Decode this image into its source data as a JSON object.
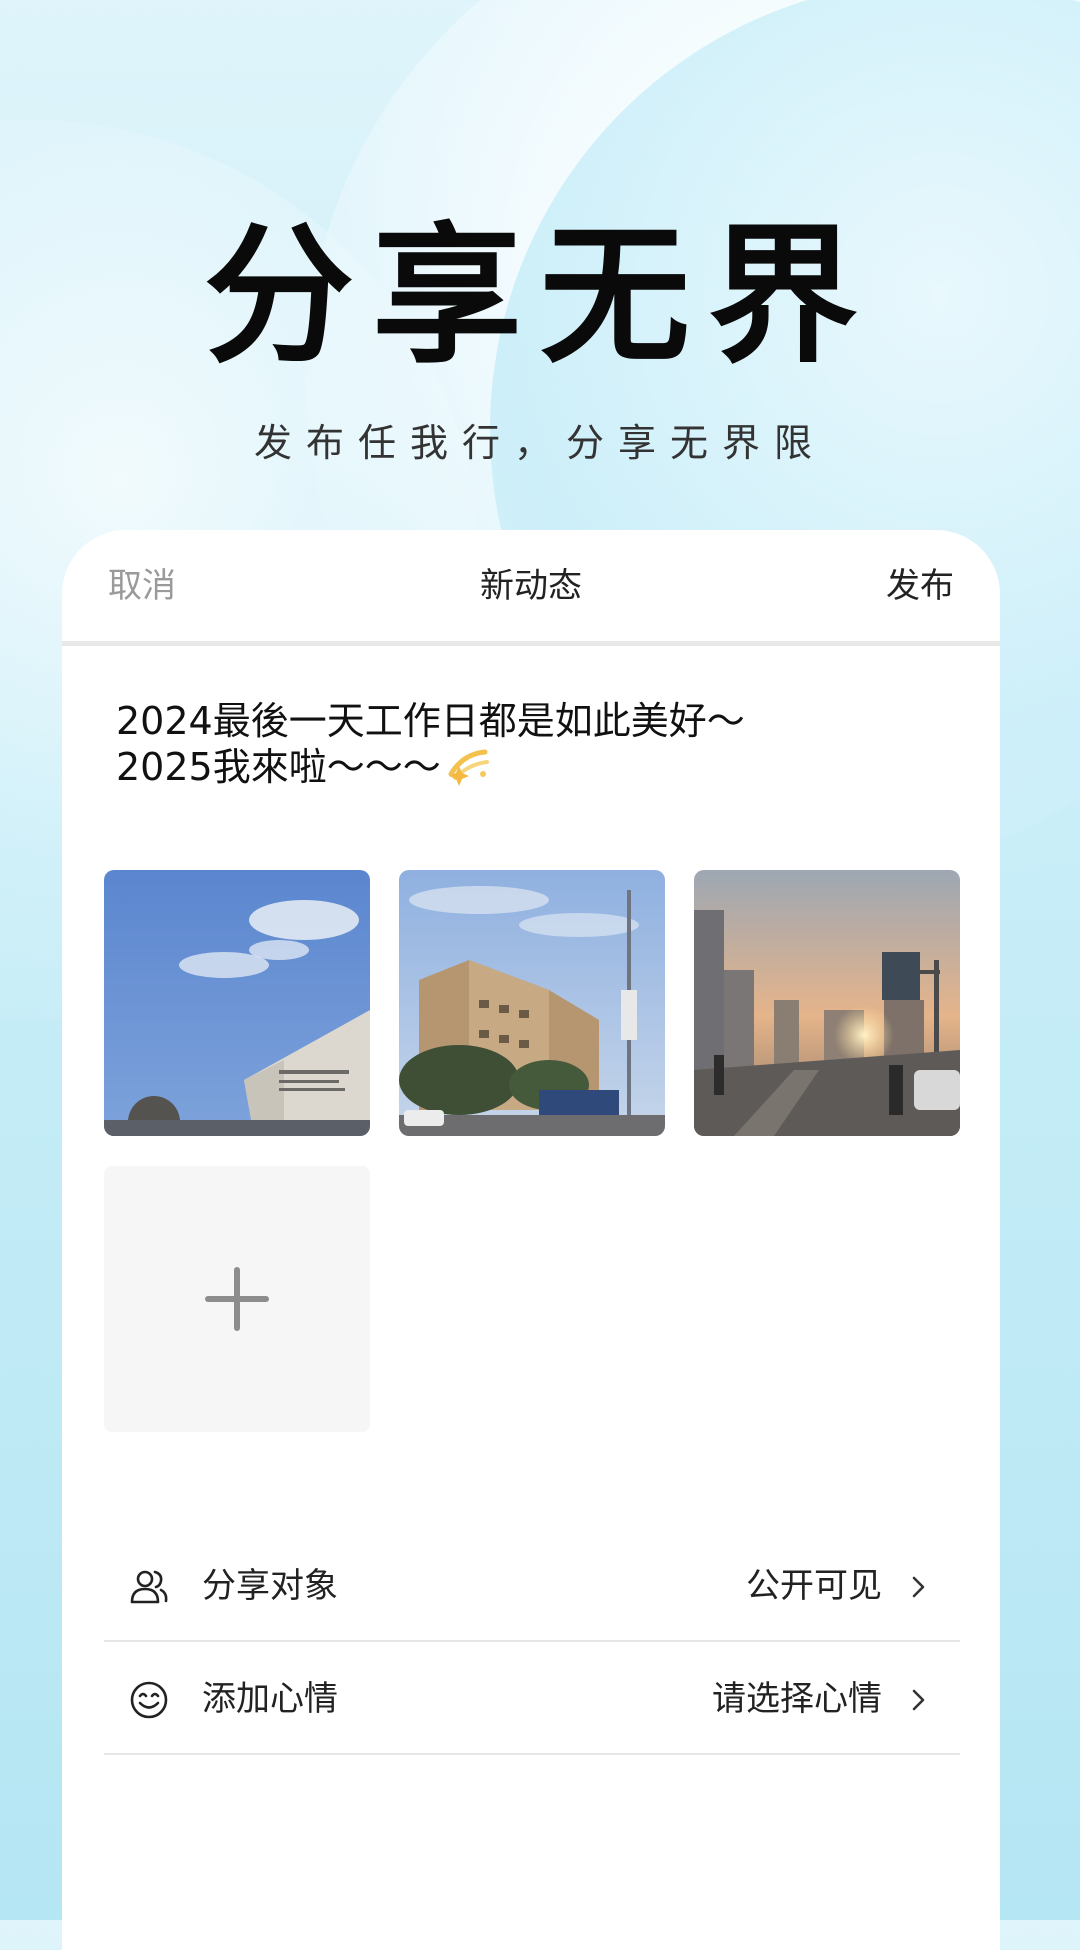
{
  "hero": {
    "title": "分享无界",
    "subtitle": "发布任我行，分享无界限"
  },
  "header": {
    "cancel_label": "取消",
    "title": "新动态",
    "publish_label": "发布"
  },
  "post": {
    "line1": "2024最後一天工作日都是如此美好～",
    "line2": "2025我來啦～～～",
    "emoji_icon": "dizzy-sparkle-icon"
  },
  "photos": [
    {
      "description_icon": "photo-building-blue-sky"
    },
    {
      "description_icon": "photo-apartment-street"
    },
    {
      "description_icon": "photo-sunset-road"
    }
  ],
  "add_photo": {
    "icon": "plus-icon"
  },
  "settings": {
    "share": {
      "icon": "users-icon",
      "label": "分享对象",
      "value": "公开可见"
    },
    "mood": {
      "icon": "smile-icon",
      "label": "添加心情",
      "value": "请选择心情"
    }
  },
  "colors": {
    "accent_bg": "#c9eef8",
    "text_primary": "#222222",
    "text_muted": "#9a9a9a",
    "divider": "#e6e6e6"
  }
}
